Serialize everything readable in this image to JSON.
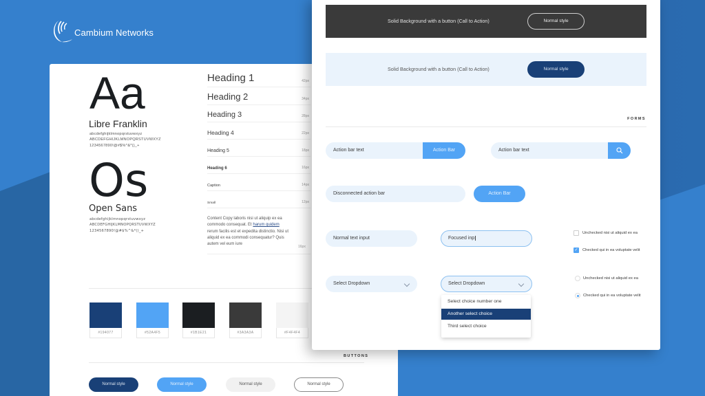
{
  "brand": {
    "name": "Cambium Networks",
    "icon": "cambium-waves-logo"
  },
  "typography": {
    "fonts": [
      {
        "sample": "Aa",
        "name": "Libre Franklin",
        "lowercase": "abcdefghijklmnopqrstuvwxyz",
        "uppercase": "ABCDEFGHIJKLMNOPQRSTUVWXYZ",
        "symbols": "1234567890!@#$%^&*()_+"
      },
      {
        "sample": "Os",
        "name": "Open Sans",
        "lowercase": "abcdefghijklmnopqrstuvwxyz",
        "uppercase": "ABCDEFGHIJKLMNOPQRSTUVWXYZ",
        "symbols": "1234567890!@#$%^&*()_+"
      }
    ],
    "headings": [
      {
        "label": "Heading 1",
        "size": "42px"
      },
      {
        "label": "Heading 2",
        "size": "34px"
      },
      {
        "label": "Heading 3",
        "size": "28px"
      },
      {
        "label": "Heading 4",
        "size": "22px"
      },
      {
        "label": "Heading 5",
        "size": "18px"
      },
      {
        "label": "Heading 6",
        "size": "16px"
      },
      {
        "label": "Caption",
        "size": "14px"
      },
      {
        "label": "Small",
        "size": "12px"
      }
    ],
    "content": {
      "before_link": "Content Copy laboris nisi ut aliquip ex ea commodo consequat. Et ",
      "link": "harum quidem",
      "after_link": " rerum facilis est et expedita distinctio. Nisi ut aliquid ex ea commodi consequatur? Quis autem vel eum iure",
      "size": "16px"
    }
  },
  "colors": [
    {
      "hex": "#194077",
      "label": "#194077"
    },
    {
      "hex": "#52A4F5",
      "label": "#52A4F5"
    },
    {
      "hex": "#1B1E21",
      "label": "#1B1E21"
    },
    {
      "hex": "#3A3A3A",
      "label": "#3A3A3A"
    },
    {
      "hex": "#F4F4F4",
      "label": "#F4F4F4"
    }
  ],
  "buttons": {
    "section_title": "BUTTONS",
    "items": [
      {
        "label": "Normal style",
        "variant": "dark-blue"
      },
      {
        "label": "Normal style",
        "variant": "light-blue"
      },
      {
        "label": "Normal style",
        "variant": "gray"
      },
      {
        "label": "Normal style",
        "variant": "outline"
      }
    ]
  },
  "cta": [
    {
      "text": "Solid Background with a button (Call to Action)",
      "button": "Normal style",
      "variant": "dark"
    },
    {
      "text": "Solid Background with a button (Call to Action)",
      "button": "Normal style",
      "variant": "light"
    }
  ],
  "forms": {
    "section_title": "FORMS",
    "action_bar_1": {
      "text": "Action bar text",
      "button": "Action Bar"
    },
    "action_bar_2": {
      "text": "Action bar text",
      "button_icon": "search-icon"
    },
    "disconnected": {
      "text": "Disconnected action bar",
      "button": "Action Bar"
    },
    "normal_input": {
      "value": "Normal text input"
    },
    "focused_input": {
      "value": "Focused inp"
    },
    "select_1": {
      "value": "Select Dropdown"
    },
    "select_2": {
      "value": "Select Dropdown",
      "options": [
        "Select choice number one",
        "Another select choice",
        "Third select choice"
      ],
      "highlighted_index": 1
    },
    "checkboxes": [
      {
        "label": "Unchecked nisi ut aliquid ex ea",
        "checked": false
      },
      {
        "label": "Checked qui in ea voluptate velit",
        "checked": true
      }
    ],
    "radios": [
      {
        "label": "Unchecked nisi ut aliquid ex ea",
        "checked": false
      },
      {
        "label": "Checked qui in ea voluptate velit",
        "checked": true
      }
    ]
  }
}
